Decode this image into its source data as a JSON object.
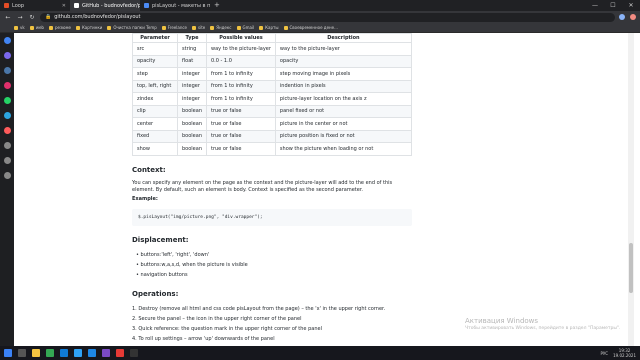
{
  "browser": {
    "tabs": [
      {
        "title": "Loop",
        "color": "#e44d26",
        "active": false
      },
      {
        "title": "GitHub - budnovfedor/pi...",
        "color": "#ffffff",
        "active": true
      },
      {
        "title": "pisLayout - макеты в па...",
        "color": "#4c8bf5",
        "active": false
      }
    ],
    "new_tab": "+",
    "window_controls": [
      "—",
      "☐",
      "✕"
    ],
    "url": "github.com/budnovfedor/pislayout",
    "bookmarks": [
      "vk",
      "web",
      "резюме",
      "Картинки",
      "Очистка папки Temp",
      "Freelance",
      "site",
      "Яндекс",
      "Gmail",
      "Карты",
      "Своевременное дене..."
    ]
  },
  "table": {
    "headers": [
      "Parameter",
      "Type",
      "Possible values",
      "Description"
    ],
    "rows": [
      [
        "src",
        "string",
        "way to the picture-layer",
        "way to the picture-layer"
      ],
      [
        "opacity",
        "float",
        "0.0 - 1.0",
        "opacity"
      ],
      [
        "step",
        "integer",
        "from 1 to infinity",
        "step moving image in pixels"
      ],
      [
        "top, left, right",
        "integer",
        "from 1 to infinity",
        "indention in pixels"
      ],
      [
        "zindex",
        "integer",
        "from 1 to infinity",
        "picture-layer location on the axis z"
      ],
      [
        "clip",
        "boolean",
        "true or false",
        "panel fixed or not"
      ],
      [
        "center",
        "boolean",
        "true or false",
        "picture in the center or not"
      ],
      [
        "fixed",
        "boolean",
        "true or false",
        "picture position is fixed or not"
      ],
      [
        "show",
        "boolean",
        "true or false",
        "show the picture when loading or not"
      ]
    ]
  },
  "context": {
    "heading": "Context:",
    "text": "You can specify any element on the page as the context and the picture-layer will add to the end of this element. By default, such an element is body. Context is specified as the second parameter.",
    "example_label": "Example:",
    "code": "$.pisLayout(\"img/picture.png\", \"div.wrapper\");"
  },
  "displacement": {
    "heading": "Displacement:",
    "items": [
      "buttons:'left', 'right', 'down'",
      "buttons:w,a,s,d, when the picture is visible",
      "navigation buttons"
    ]
  },
  "operations": {
    "heading": "Operations:",
    "items": [
      "1. Destroy (remove all html and css code pisLayout from the page) – the 'x' in the upper right corner.",
      "2. Secure the panel – the icon in the upper right corner of the panel",
      "3. Quick reference: the question mark in the upper right corner of the panel",
      "4. To roll up settings – arrow 'up' downwards of the panel",
      "5. Show/hide the picture – the center button of the navigation bar or shift+e"
    ]
  },
  "watermark": {
    "title": "Активация Windows",
    "subtitle": "Чтобы активировать Windows, перейдите в раздел \"Параметры\"."
  },
  "taskbar": {
    "time": "19:32",
    "date": "19.02.2021",
    "lang": "РУС"
  }
}
